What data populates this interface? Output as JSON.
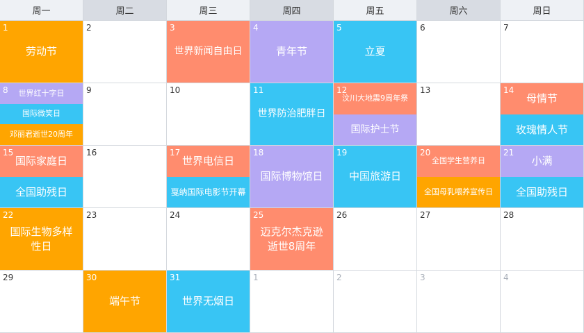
{
  "colors": {
    "orange": "#ffa500",
    "salmon": "#ff8c6e",
    "purple": "#b5a8f4",
    "blue": "#38c5f4",
    "header_bg": "#eef1f5",
    "header_shaded": "#d8dce3"
  },
  "weekdays": [
    {
      "label": "周一",
      "shade": false
    },
    {
      "label": "周二",
      "shade": true
    },
    {
      "label": "周三",
      "shade": false
    },
    {
      "label": "周四",
      "shade": true
    },
    {
      "label": "周五",
      "shade": false
    },
    {
      "label": "周六",
      "shade": true
    },
    {
      "label": "周日",
      "shade": false
    }
  ],
  "weeks": [
    [
      {
        "day": "1",
        "events": [
          {
            "title": "劳动节",
            "color": "orange",
            "size": 15
          }
        ]
      },
      {
        "day": "2",
        "events": []
      },
      {
        "day": "3",
        "events": [
          {
            "title": "世界新闻自由日",
            "color": "salmon",
            "size": 14
          }
        ]
      },
      {
        "day": "4",
        "events": [
          {
            "title": "青年节",
            "color": "purple",
            "size": 15
          }
        ]
      },
      {
        "day": "5",
        "events": [
          {
            "title": "立夏",
            "color": "blue",
            "size": 15
          }
        ]
      },
      {
        "day": "6",
        "events": []
      },
      {
        "day": "7",
        "events": []
      }
    ],
    [
      {
        "day": "8",
        "events": [
          {
            "title": "世界红十字日",
            "color": "purple",
            "size": 11
          },
          {
            "title": "国际微笑日",
            "color": "blue",
            "size": 11
          },
          {
            "title": "邓丽君逝世20周年",
            "color": "orange",
            "size": 11
          }
        ]
      },
      {
        "day": "9",
        "events": []
      },
      {
        "day": "10",
        "events": []
      },
      {
        "day": "11",
        "events": [
          {
            "title": "世界防治肥胖日",
            "color": "blue",
            "size": 14
          }
        ]
      },
      {
        "day": "12",
        "events": [
          {
            "title": "汶川大地震9周年祭",
            "color": "salmon",
            "size": 11
          },
          {
            "title": "国际护士节",
            "color": "purple",
            "size": 14
          }
        ]
      },
      {
        "day": "13",
        "events": []
      },
      {
        "day": "14",
        "events": [
          {
            "title": "母情节",
            "color": "salmon",
            "size": 15
          },
          {
            "title": "玫瑰情人节",
            "color": "blue",
            "size": 15
          }
        ]
      }
    ],
    [
      {
        "day": "15",
        "events": [
          {
            "title": "国际家庭日",
            "color": "salmon",
            "size": 15
          },
          {
            "title": "全国助残日",
            "color": "blue",
            "size": 15
          }
        ]
      },
      {
        "day": "16",
        "events": []
      },
      {
        "day": "17",
        "events": [
          {
            "title": "世界电信日",
            "color": "salmon",
            "size": 15
          },
          {
            "title": "戛纳国际电影节开幕",
            "color": "blue",
            "size": 12
          }
        ]
      },
      {
        "day": "18",
        "events": [
          {
            "title": "国际博物馆日",
            "color": "purple",
            "size": 15
          }
        ]
      },
      {
        "day": "19",
        "events": [
          {
            "title": "中国旅游日",
            "color": "blue",
            "size": 15
          }
        ]
      },
      {
        "day": "20",
        "events": [
          {
            "title": "全国学生营养日",
            "color": "salmon",
            "size": 11
          },
          {
            "title": "全国母乳喂养宣传日",
            "color": "orange",
            "size": 11
          }
        ]
      },
      {
        "day": "21",
        "events": [
          {
            "title": "小满",
            "color": "purple",
            "size": 15
          },
          {
            "title": "全国助残日",
            "color": "blue",
            "size": 15
          }
        ]
      }
    ],
    [
      {
        "day": "22",
        "events": [
          {
            "title": "国际生物多样性日",
            "color": "orange",
            "size": 15,
            "wrap": true
          }
        ]
      },
      {
        "day": "23",
        "events": []
      },
      {
        "day": "24",
        "events": []
      },
      {
        "day": "25",
        "events": [
          {
            "title": "迈克尔杰克逊逝世8周年",
            "color": "salmon",
            "size": 15,
            "wrap": true
          }
        ]
      },
      {
        "day": "26",
        "events": []
      },
      {
        "day": "27",
        "events": []
      },
      {
        "day": "28",
        "events": []
      }
    ],
    [
      {
        "day": "29",
        "events": []
      },
      {
        "day": "30",
        "events": [
          {
            "title": "端午节",
            "color": "orange",
            "size": 15
          }
        ]
      },
      {
        "day": "31",
        "events": [
          {
            "title": "世界无烟日",
            "color": "blue",
            "size": 15
          }
        ]
      },
      {
        "day": "1",
        "other": true,
        "events": []
      },
      {
        "day": "2",
        "other": true,
        "events": []
      },
      {
        "day": "3",
        "other": true,
        "events": []
      },
      {
        "day": "4",
        "other": true,
        "events": []
      }
    ]
  ]
}
